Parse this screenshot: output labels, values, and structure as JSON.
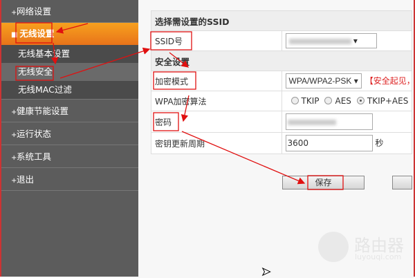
{
  "sidebar": {
    "items": [
      {
        "label": "网络设置"
      },
      {
        "label": "无线设置"
      },
      {
        "label": "健康节能设置"
      },
      {
        "label": "运行状态"
      },
      {
        "label": "系统工具"
      },
      {
        "label": "退出"
      }
    ],
    "sub": [
      {
        "label": "无线基本设置"
      },
      {
        "label": "无线安全"
      },
      {
        "label": "无线MAC过滤"
      }
    ]
  },
  "main": {
    "ssid_header": "选择需设置的SSID",
    "ssid_label": "SSID号",
    "security_header": "安全设置",
    "mode_label": "加密模式",
    "mode_value": "WPA/WPA2-PSK",
    "mode_warning": "【安全起见，推荐",
    "algo_label": "WPA加密算法",
    "algo_options": [
      "TKIP",
      "AES",
      "TKIP+AES"
    ],
    "algo_selected": "TKIP+AES",
    "password_label": "密码",
    "renew_label": "密钥更新周期",
    "renew_value": "3600",
    "renew_unit": "秒",
    "save_label": "保存"
  },
  "watermark": {
    "name": "路由器",
    "url": "luyouqi.com"
  },
  "colors": {
    "accent": "#f39a1f",
    "annotation": "#e01010"
  }
}
